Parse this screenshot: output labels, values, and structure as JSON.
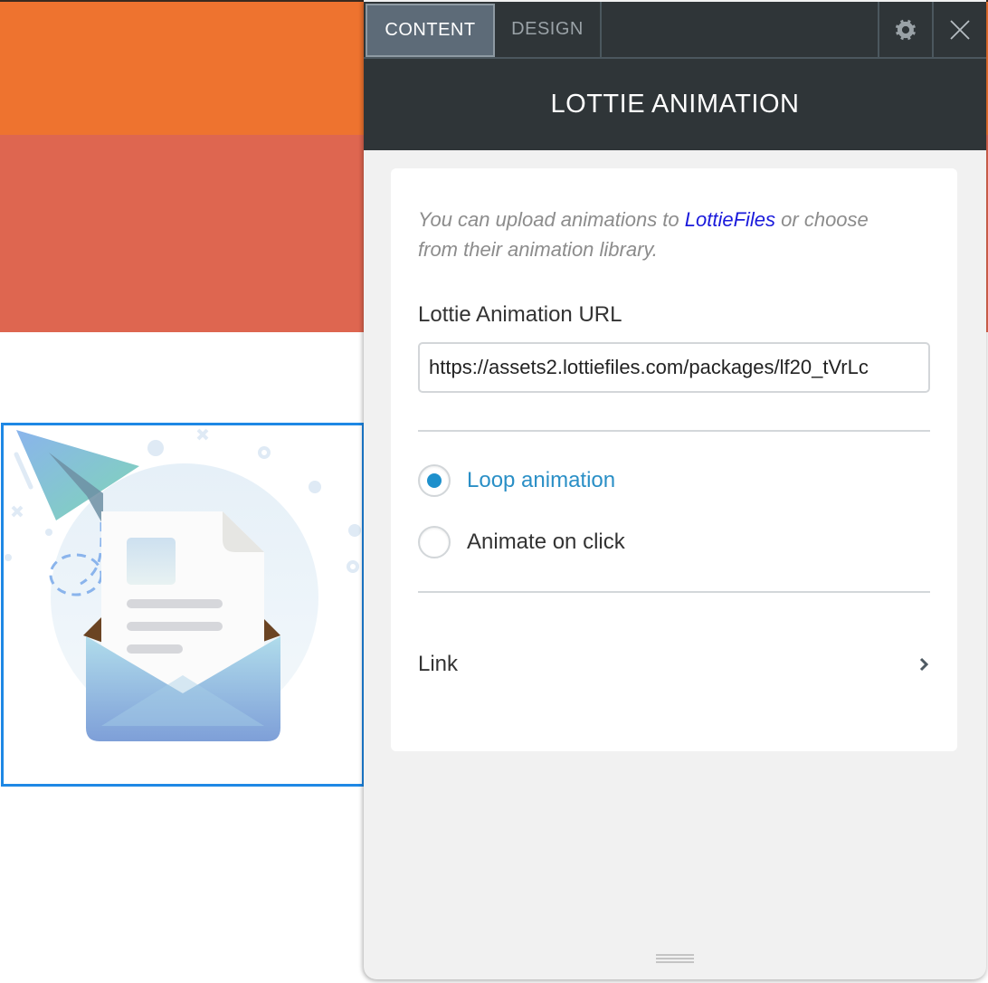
{
  "canvas": {
    "colors": {
      "orange_band": "#ee732f",
      "red_band": "#de6650",
      "selection": "#1e88e5"
    },
    "lottie_illustration": "envelope-with-letter-and-paper-plane"
  },
  "panel": {
    "tabs": [
      {
        "label": "CONTENT",
        "active": true
      },
      {
        "label": "DESIGN",
        "active": false
      }
    ],
    "settings_icon": "gear-icon",
    "close_icon": "close-icon",
    "title": "LOTTIE ANIMATION",
    "help": {
      "prefix": "You can upload animations to ",
      "link_text": "LottieFiles",
      "suffix": " or choose from their animation library."
    },
    "url_field": {
      "label": "Lottie Animation URL",
      "value": "https://assets2.lottiefiles.com/packages/lf20_tVrLc"
    },
    "playback_options": [
      {
        "label": "Loop animation",
        "selected": true
      },
      {
        "label": "Animate on click",
        "selected": false
      }
    ],
    "link_row": {
      "label": "Link",
      "icon": "chevron-right-icon"
    },
    "colors": {
      "accent": "#1e90cc",
      "link": "#1a1adb",
      "header_bg": "#2f3538"
    }
  }
}
